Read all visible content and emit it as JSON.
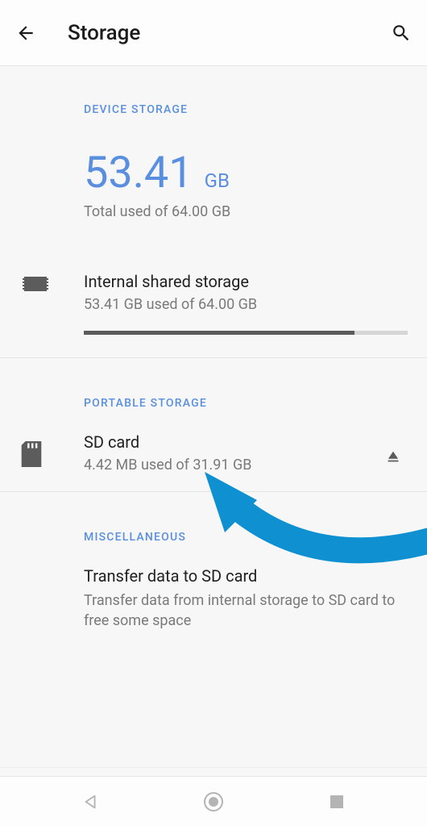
{
  "appbar": {
    "title": "Storage"
  },
  "device": {
    "header": "DEVICE STORAGE",
    "used_value": "53.41",
    "used_unit": "GB",
    "total_line": "Total used of 64.00 GB"
  },
  "internal": {
    "title": "Internal shared storage",
    "sub": "53.41 GB used of 64.00 GB",
    "progress_percent": 83.5
  },
  "portable": {
    "header": "PORTABLE STORAGE",
    "title": "SD card",
    "sub": "4.42 MB used of 31.91 GB"
  },
  "misc": {
    "header": "MISCELLANEOUS",
    "title": "Transfer data to SD card",
    "sub": "Transfer data from internal storage to SD card to free some space"
  }
}
